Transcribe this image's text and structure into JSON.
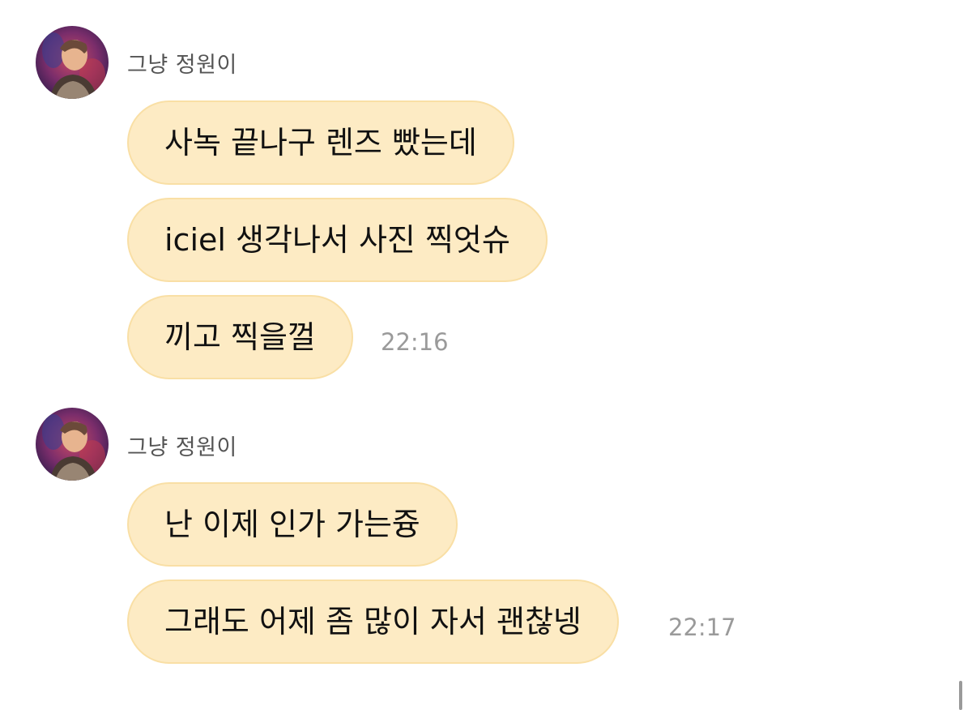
{
  "groups": [
    {
      "sender": "그냥 정원이",
      "avatar_icon": "profile-photo",
      "messages": [
        "사녹 끝나구 렌즈 빴는데",
        "iciel  생각나서 사진 찍엇슈",
        "끼고 찍을껄"
      ],
      "time": "22:16"
    },
    {
      "sender": "그냥 정원이",
      "avatar_icon": "profile-photo",
      "messages": [
        "난 이제 인가 가는즁",
        "그래도 어제 좀 많이 자서 괜찮넹"
      ],
      "time": "22:17"
    }
  ],
  "colors": {
    "bubble_fill": "#fdebc4",
    "bubble_border": "#f9dfa5",
    "sender_text": "#555555",
    "time_text": "#9a9a9a"
  }
}
